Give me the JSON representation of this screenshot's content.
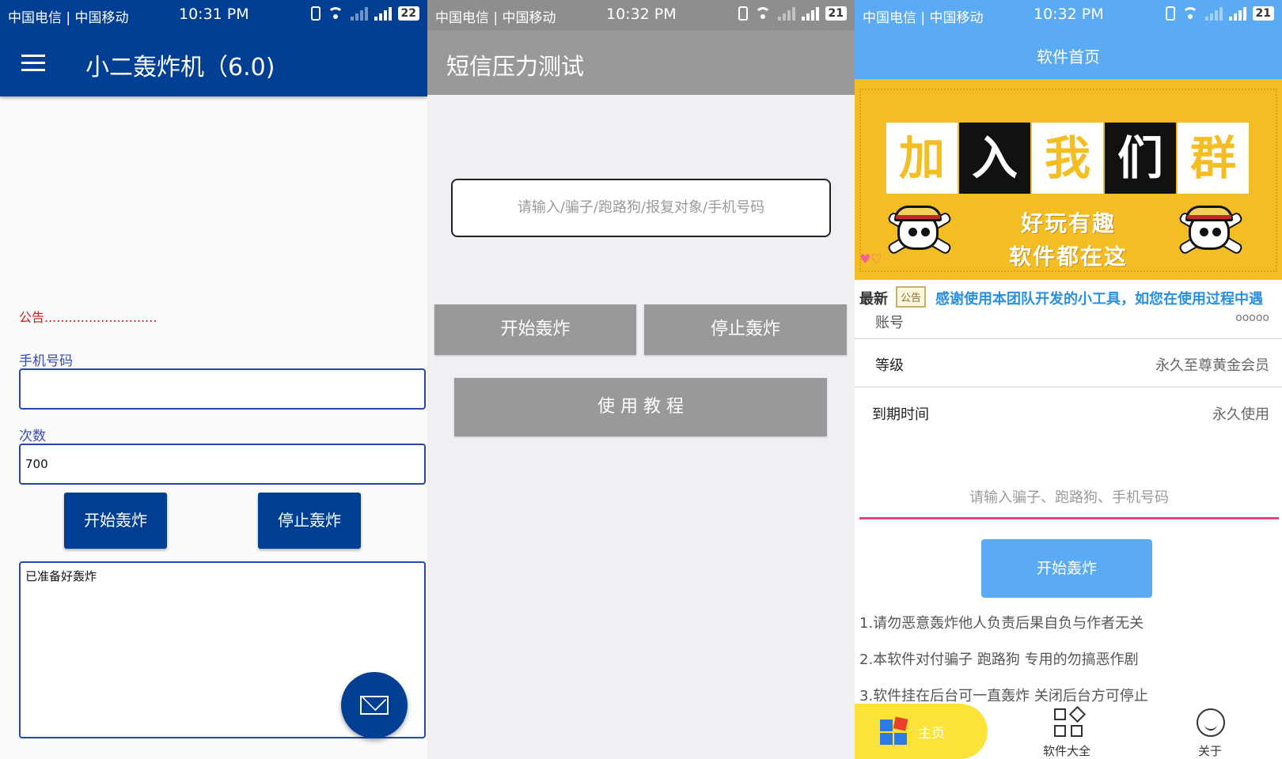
{
  "status_bars": [
    {
      "carrier": "中国电信 | 中国移动",
      "time": "10:31 PM",
      "battery": "22"
    },
    {
      "carrier": "中国电信 | 中国移动",
      "time": "10:32 PM",
      "battery": "21"
    },
    {
      "carrier": "中国电信 | 中国移动",
      "time": "10:32 PM",
      "battery": "21"
    }
  ],
  "app1": {
    "title": "小二轰炸机（6.0)",
    "notice": "公告............................",
    "phone_label": "手机号码",
    "phone_value": "",
    "count_label": "次数",
    "count_value": "700",
    "start_label": "开始轰炸",
    "stop_label": "停止轰炸",
    "log_text": "已准备好轰炸",
    "accent": "#003f94"
  },
  "app2": {
    "title": "短信压力测试",
    "input_placeholder": "请输入/骗子/跑路狗/报复对象/手机号码",
    "start_label": "开始轰炸",
    "stop_label": "停止轰炸",
    "tutorial_label": "使 用 教 程",
    "accent": "#999999"
  },
  "app3": {
    "title": "软件首页",
    "banner": {
      "word1": "加",
      "word2": "入",
      "word3": "我",
      "word4": "们",
      "word5": "群",
      "line1": "好玩有趣",
      "line2": "软件都在这"
    },
    "news_tag": "最新",
    "news_badge": "公告",
    "news_text": "感谢使用本团队开发的小工具，如您在使用过程中遇",
    "account_label": "账号",
    "account_value": "ooooo",
    "level_label": "等级",
    "level_value": "永久至尊黄金会员",
    "expire_label": "到期时间",
    "expire_value": "永久使用",
    "input_placeholder": "请输入骗子、跑路狗、手机号码",
    "start_label": "开始轰炸",
    "tips": [
      "1.请勿恶意轰炸他人负责后果自负与作者无关",
      "2.本软件对付骗子 跑路狗 专用的勿搞恶作剧",
      "3.软件挂在后台可一直轰炸 关闭后台方可停止"
    ],
    "tabs": [
      {
        "label": "主页",
        "icon": "tiles-icon"
      },
      {
        "label": "软件大全",
        "icon": "grid-icon"
      },
      {
        "label": "关于",
        "icon": "smile-icon"
      }
    ],
    "accent": "#5aaaf4"
  }
}
